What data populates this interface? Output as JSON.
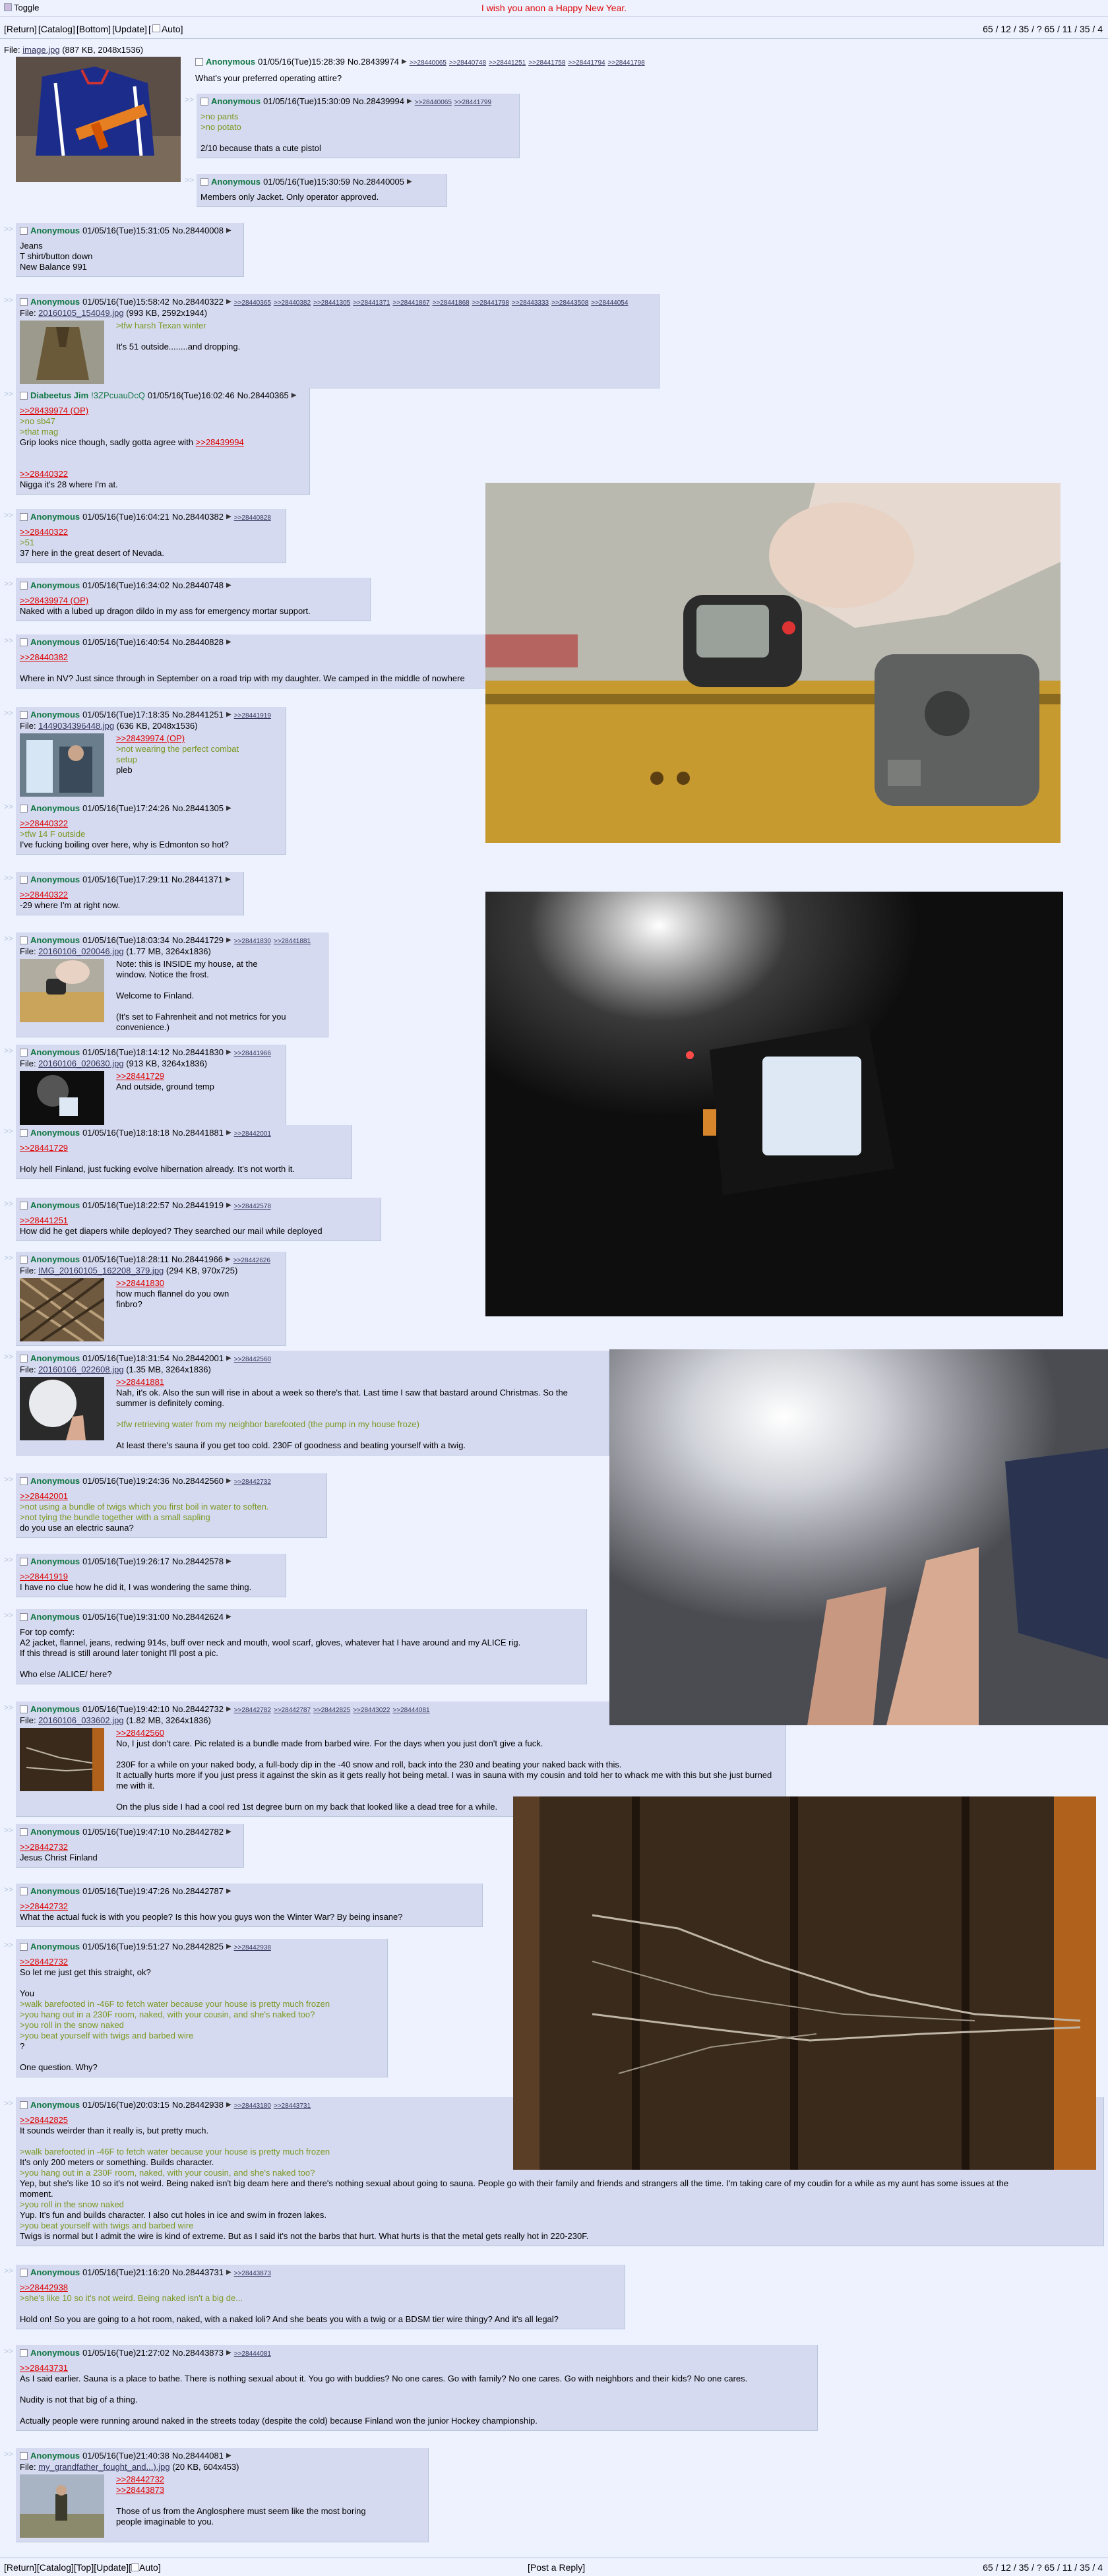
{
  "top": {
    "toggle_label": "Toggle",
    "greeting": "I wish you anon a Happy New Year.",
    "nav": [
      "[Return]",
      "[Catalog]",
      "[Bottom]",
      "[Update]",
      "[",
      "Auto]"
    ],
    "stats": "65 / 12 / 35 / ? 65 / 11 / 35 / 4"
  },
  "op": {
    "file_label": "File:",
    "file_name": "image.jpg",
    "file_meta": "(887 KB, 2048x1536)",
    "name": "Anonymous",
    "date": "01/05/16(Tue)15:28:39",
    "no": "No.28439974",
    "backlinks": [
      ">>28440065",
      ">>28440748",
      ">>28441251",
      ">>28441758",
      ">>28441794",
      ">>28441798"
    ],
    "message": "What's your preferred operating attire?"
  },
  "posts": [
    {
      "name": "Anonymous",
      "date": "01/05/16(Tue)15:30:09",
      "no": "No.28439994",
      "backlinks": [
        ">>28440065",
        ">>28441799"
      ],
      "lines": [
        {
          "t": "gt",
          "v": ">no pants"
        },
        {
          "t": "gt",
          "v": ">no potato"
        },
        {
          "t": "n",
          "v": ""
        },
        {
          "t": "n",
          "v": "2/10 because thats a cute pistol"
        }
      ]
    },
    {
      "name": "Anonymous",
      "date": "01/05/16(Tue)15:30:59",
      "no": "No.28440005",
      "backlinks": [],
      "lines": [
        {
          "t": "n",
          "v": "Members only Jacket. Only operator approved."
        }
      ]
    },
    {
      "name": "Anonymous",
      "date": "01/05/16(Tue)15:31:05",
      "no": "No.28440008",
      "backlinks": [],
      "lines": [
        {
          "t": "n",
          "v": "Jeans"
        },
        {
          "t": "n",
          "v": "T shirt/button down"
        },
        {
          "t": "n",
          "v": "New Balance 991"
        }
      ]
    },
    {
      "name": "Anonymous",
      "date": "01/05/16(Tue)15:58:42",
      "no": "No.28440322",
      "backlinks": [
        ">>28440365",
        ">>28440382",
        ">>28441305",
        ">>28441371",
        ">>28441867",
        ">>28441868",
        ">>28441798",
        ">>28443333",
        ">>28443508",
        ">>28444054"
      ],
      "file": {
        "name": "20160105_154049.jpg",
        "meta": "(993 KB, 2592x1944)"
      },
      "lines": [
        {
          "t": "gt",
          "v": ">tfw harsh Texan winter"
        },
        {
          "t": "n",
          "v": ""
        },
        {
          "t": "n",
          "v": "It's 51 outside........and dropping."
        }
      ]
    },
    {
      "name": "Diabeetus Jim",
      "trip": "!3ZPcuauDcQ",
      "date": "01/05/16(Tue)16:02:46",
      "no": "No.28440365",
      "backlinks": [],
      "lines": [
        {
          "t": "ql",
          "v": ">>28439974 (OP)"
        },
        {
          "t": "gt",
          "v": ">no sb47"
        },
        {
          "t": "gt",
          "v": ">that mag"
        },
        {
          "t": "mix",
          "v": "Grip looks nice though, sadly gotta agree with ",
          "q": ">>28439994"
        },
        {
          "t": "n",
          "v": ""
        },
        {
          "t": "n",
          "v": ""
        },
        {
          "t": "ql",
          "v": ">>28440322"
        },
        {
          "t": "n",
          "v": "Nigga it's 28 where I'm at."
        }
      ]
    },
    {
      "name": "Anonymous",
      "date": "01/05/16(Tue)16:04:21",
      "no": "No.28440382",
      "backlinks": [
        ">>28440828"
      ],
      "lines": [
        {
          "t": "ql",
          "v": ">>28440322"
        },
        {
          "t": "gt",
          "v": ">51"
        },
        {
          "t": "n",
          "v": "37 here in the great desert of Nevada."
        }
      ]
    },
    {
      "name": "Anonymous",
      "date": "01/05/16(Tue)16:34:02",
      "no": "No.28440748",
      "backlinks": [],
      "lines": [
        {
          "t": "ql",
          "v": ">>28439974 (OP)"
        },
        {
          "t": "n",
          "v": "Naked with a lubed up dragon dildo in my ass for emergency mortar support."
        }
      ]
    },
    {
      "name": "Anonymous",
      "date": "01/05/16(Tue)16:40:54",
      "no": "No.28440828",
      "backlinks": [],
      "lines": [
        {
          "t": "ql",
          "v": ">>28440382"
        },
        {
          "t": "n",
          "v": ""
        },
        {
          "t": "n",
          "v": "Where in NV? Just since through in September on a road trip with my daughter. We camped in the middle of nowhere"
        }
      ]
    },
    {
      "name": "Anonymous",
      "date": "01/05/16(Tue)17:18:35",
      "no": "No.28441251",
      "backlinks": [
        ">>28441919"
      ],
      "file": {
        "name": "1449034396448.jpg",
        "meta": "(636 KB, 2048x1536)"
      },
      "lines": [
        {
          "t": "ql",
          "v": ">>28439974 (OP)"
        },
        {
          "t": "gt",
          "v": ">not wearing the perfect combat"
        },
        {
          "t": "gt",
          "v": "setup"
        },
        {
          "t": "n",
          "v": "pleb"
        }
      ]
    },
    {
      "name": "Anonymous",
      "date": "01/05/16(Tue)17:24:26",
      "no": "No.28441305",
      "backlinks": [],
      "lines": [
        {
          "t": "ql",
          "v": ">>28440322"
        },
        {
          "t": "gt",
          "v": ">tfw 14 F outside"
        },
        {
          "t": "n",
          "v": "I've fucking boiling over here, why is Edmonton so hot?"
        }
      ]
    },
    {
      "name": "Anonymous",
      "date": "01/05/16(Tue)17:29:11",
      "no": "No.28441371",
      "backlinks": [],
      "lines": [
        {
          "t": "ql",
          "v": ">>28440322"
        },
        {
          "t": "n",
          "v": "-29 where I'm at right now."
        }
      ]
    },
    {
      "name": "Anonymous",
      "date": "01/05/16(Tue)18:03:34",
      "no": "No.28441729",
      "backlinks": [
        ">>28441830",
        ">>28441881"
      ],
      "file": {
        "name": "20160106_020046.jpg",
        "meta": "(1.77 MB, 3264x1836)"
      },
      "lines": [
        {
          "t": "n",
          "v": "Note: this is INSIDE my house, at the"
        },
        {
          "t": "n",
          "v": "window. Notice the frost."
        },
        {
          "t": "n",
          "v": ""
        },
        {
          "t": "n",
          "v": "Welcome to Finland."
        },
        {
          "t": "n",
          "v": ""
        },
        {
          "t": "n",
          "v": "(It's set to Fahrenheit and not metrics for you convenience.)"
        }
      ]
    },
    {
      "name": "Anonymous",
      "date": "01/05/16(Tue)18:14:12",
      "no": "No.28441830",
      "backlinks": [
        ">>28441966"
      ],
      "file": {
        "name": "20160106_020630.jpg",
        "meta": "(913 KB, 3264x1836)"
      },
      "lines": [
        {
          "t": "ql",
          "v": ">>28441729"
        },
        {
          "t": "n",
          "v": "And outside, ground temp"
        }
      ]
    },
    {
      "name": "Anonymous",
      "date": "01/05/16(Tue)18:18:18",
      "no": "No.28441881",
      "backlinks": [
        ">>28442001"
      ],
      "lines": [
        {
          "t": "ql",
          "v": ">>28441729"
        },
        {
          "t": "n",
          "v": ""
        },
        {
          "t": "n",
          "v": "Holy hell Finland, just fucking evolve hibernation already. It's not worth it."
        }
      ]
    },
    {
      "name": "Anonymous",
      "date": "01/05/16(Tue)18:22:57",
      "no": "No.28441919",
      "backlinks": [
        ">>28442578"
      ],
      "lines": [
        {
          "t": "ql",
          "v": ">>28441251"
        },
        {
          "t": "n",
          "v": "How did he get diapers while deployed? They searched our mail while deployed"
        }
      ]
    },
    {
      "name": "Anonymous",
      "date": "01/05/16(Tue)18:28:11",
      "no": "No.28441966",
      "backlinks": [
        ">>28442626"
      ],
      "file": {
        "name": "IMG_20160105_162208_379.jpg",
        "meta": "(294 KB, 970x725)"
      },
      "lines": [
        {
          "t": "ql",
          "v": ">>28441830"
        },
        {
          "t": "n",
          "v": "how much flannel do you own"
        },
        {
          "t": "n",
          "v": "finbro?"
        }
      ]
    },
    {
      "name": "Anonymous",
      "date": "01/05/16(Tue)18:31:54",
      "no": "No.28442001",
      "backlinks": [
        ">>28442560"
      ],
      "file": {
        "name": "20160106_022608.jpg",
        "meta": "(1.35 MB, 3264x1836)"
      },
      "lines": [
        {
          "t": "ql",
          "v": ">>28441881"
        },
        {
          "t": "n",
          "v": "Nah, it's ok. Also the sun will rise in about a week so there's that. Last time I saw that bastard around Christmas. So the"
        },
        {
          "t": "n",
          "v": "summer is definitely coming."
        },
        {
          "t": "n",
          "v": ""
        },
        {
          "t": "gt",
          "v": ">tfw retrieving water from my neighbor barefooted (the pump in my house froze)"
        },
        {
          "t": "n",
          "v": ""
        },
        {
          "t": "n",
          "v": "At least there's sauna if you get too cold. 230F of goodness and beating yourself with a twig."
        }
      ]
    },
    {
      "name": "Anonymous",
      "date": "01/05/16(Tue)19:24:36",
      "no": "No.28442560",
      "backlinks": [
        ">>28442732"
      ],
      "lines": [
        {
          "t": "ql",
          "v": ">>28442001"
        },
        {
          "t": "gt",
          "v": ">not using a bundle of twigs which you first boil in water to soften."
        },
        {
          "t": "gt",
          "v": ">not tying the bundle together with a small sapling"
        },
        {
          "t": "n",
          "v": "do you use an electric sauna?"
        }
      ]
    },
    {
      "name": "Anonymous",
      "date": "01/05/16(Tue)19:26:17",
      "no": "No.28442578",
      "backlinks": [],
      "lines": [
        {
          "t": "ql",
          "v": ">>28441919"
        },
        {
          "t": "n",
          "v": "I have no clue how he did it, I was wondering the same thing."
        }
      ]
    },
    {
      "name": "Anonymous",
      "date": "01/05/16(Tue)19:31:00",
      "no": "No.28442624",
      "backlinks": [],
      "lines": [
        {
          "t": "n",
          "v": "For top comfy:"
        },
        {
          "t": "n",
          "v": "A2 jacket, flannel, jeans, redwing 914s, buff over neck and mouth, wool scarf, gloves, whatever hat I have around and my ALICE rig."
        },
        {
          "t": "n",
          "v": "If this thread is still around later tonight I'll post a pic."
        },
        {
          "t": "n",
          "v": ""
        },
        {
          "t": "n",
          "v": "Who else /ALICE/ here?"
        }
      ]
    },
    {
      "name": "Anonymous",
      "date": "01/05/16(Tue)19:42:10",
      "no": "No.28442732",
      "backlinks": [
        ">>28442782",
        ">>28442787",
        ">>28442825",
        ">>28443022",
        ">>28444081"
      ],
      "file": {
        "name": "20160106_033602.jpg",
        "meta": "(1.82 MB, 3264x1836)"
      },
      "lines": [
        {
          "t": "ql",
          "v": ">>28442560"
        },
        {
          "t": "n",
          "v": "No, I just don't care. Pic related is a bundle made from barbed wire. For the days when you just don't give a fuck."
        },
        {
          "t": "n",
          "v": ""
        },
        {
          "t": "n",
          "v": "230F for a while on your naked body, a full-body dip in the -40 snow and roll, back into the 230 and beating your naked back with this."
        },
        {
          "t": "n",
          "v": "It actually hurts more if you just press it against the skin as it gets really hot being metal. I was in sauna with my cousin and told her to whack me with this but she just burned me with it."
        },
        {
          "t": "n",
          "v": ""
        },
        {
          "t": "n",
          "v": "On the plus side I had a cool red 1st degree burn on my back that looked like a dead tree for a while."
        }
      ]
    },
    {
      "name": "Anonymous",
      "date": "01/05/16(Tue)19:47:10",
      "no": "No.28442782",
      "backlinks": [],
      "lines": [
        {
          "t": "ql",
          "v": ">>28442732"
        },
        {
          "t": "n",
          "v": "Jesus Christ Finland"
        }
      ]
    },
    {
      "name": "Anonymous",
      "date": "01/05/16(Tue)19:47:26",
      "no": "No.28442787",
      "backlinks": [],
      "lines": [
        {
          "t": "ql",
          "v": ">>28442732"
        },
        {
          "t": "n",
          "v": "What the actual fuck is with you people? Is this how you guys won the Winter War? By being insane?"
        }
      ]
    },
    {
      "name": "Anonymous",
      "date": "01/05/16(Tue)19:51:27",
      "no": "No.28442825",
      "backlinks": [
        ">>28442938"
      ],
      "lines": [
        {
          "t": "ql",
          "v": ">>28442732"
        },
        {
          "t": "n",
          "v": "So let me just get this straight, ok?"
        },
        {
          "t": "n",
          "v": ""
        },
        {
          "t": "n",
          "v": "You"
        },
        {
          "t": "gt",
          "v": ">walk barefooted in -46F to fetch water because your house is pretty much frozen"
        },
        {
          "t": "gt",
          "v": ">you hang out in a 230F room, naked, with your cousin, and she's naked too?"
        },
        {
          "t": "gt",
          "v": ">you roll in the snow naked"
        },
        {
          "t": "gt",
          "v": ">you beat yourself with twigs and barbed wire"
        },
        {
          "t": "n",
          "v": "?"
        },
        {
          "t": "n",
          "v": ""
        },
        {
          "t": "n",
          "v": "One question. Why?"
        }
      ]
    },
    {
      "name": "Anonymous",
      "date": "01/05/16(Tue)20:03:15",
      "no": "No.28442938",
      "backlinks": [
        ">>28443180",
        ">>28443731"
      ],
      "lines": [
        {
          "t": "ql",
          "v": ">>28442825"
        },
        {
          "t": "n",
          "v": "It sounds weirder than it really is, but pretty much."
        },
        {
          "t": "n",
          "v": ""
        },
        {
          "t": "gt",
          "v": ">walk barefooted in -46F to fetch water because your house is pretty much frozen"
        },
        {
          "t": "n",
          "v": "It's only 200 meters or something. Builds character."
        },
        {
          "t": "gt",
          "v": ">you hang out in a 230F room, naked, with your cousin, and she's naked too?"
        },
        {
          "t": "n",
          "v": "Yep, but she's like 10 so it's not weird. Being naked isn't big deam here and there's nothing sexual about going to sauna. People go with their family and friends and strangers all the time. I'm taking care of my coudin for a while as my aunt has some issues at the"
        },
        {
          "t": "n",
          "v": "moment."
        },
        {
          "t": "gt",
          "v": ">you roll in the snow naked"
        },
        {
          "t": "n",
          "v": "Yup. It's fun and builds character. I also cut holes in ice and swim in frozen lakes."
        },
        {
          "t": "gt",
          "v": ">you beat yourself with twigs and barbed wire"
        },
        {
          "t": "n",
          "v": "Twigs is normal but I admit the wire is kind of extreme. But as I said it's not the barbs that hurt. What hurts is that the metal gets really hot in 220-230F."
        }
      ]
    },
    {
      "name": "Anonymous",
      "date": "01/05/16(Tue)21:16:20",
      "no": "No.28443731",
      "backlinks": [
        ">>28443873"
      ],
      "lines": [
        {
          "t": "ql",
          "v": ">>28442938"
        },
        {
          "t": "gt",
          "v": ">she's like 10 so it's not weird. Being naked isn't a big de..."
        },
        {
          "t": "n",
          "v": ""
        },
        {
          "t": "n",
          "v": "Hold on! So you are going to a hot room, naked, with a naked loli? And she beats you with a twig or a BDSM tier wire thingy? And it's all legal?"
        }
      ]
    },
    {
      "name": "Anonymous",
      "date": "01/05/16(Tue)21:27:02",
      "no": "No.28443873",
      "backlinks": [
        ">>28444081"
      ],
      "lines": [
        {
          "t": "ql",
          "v": ">>28443731"
        },
        {
          "t": "n",
          "v": "As I said earlier. Sauna is a place to bathe. There is nothing sexual about it. You go with buddies? No one cares. Go with family? No one cares. Go with neighbors and their kids? No one cares."
        },
        {
          "t": "n",
          "v": ""
        },
        {
          "t": "n",
          "v": "Nudity is not that big of a thing."
        },
        {
          "t": "n",
          "v": ""
        },
        {
          "t": "n",
          "v": "Actually people were running around naked in the streets today (despite the cold) because Finland won the junior Hockey championship."
        }
      ]
    },
    {
      "name": "Anonymous",
      "date": "01/05/16(Tue)21:40:38",
      "no": "No.28444081",
      "backlinks": [],
      "file": {
        "name": "my_grandfather_fought_and...).jpg",
        "meta": "(20 KB, 604x453)"
      },
      "lines": [
        {
          "t": "ql",
          "v": ">>28442732"
        },
        {
          "t": "ql",
          "v": ">>28443873"
        },
        {
          "t": "n",
          "v": ""
        },
        {
          "t": "n",
          "v": "Those of us from the Anglosphere must seem like the most boring"
        },
        {
          "t": "n",
          "v": "people imaginable to you."
        }
      ]
    }
  ],
  "bottom": {
    "nav": [
      "[Return]",
      "[Catalog]",
      "[Top]",
      "[Update]",
      "[",
      "Auto]"
    ],
    "post_reply": "[Post a Reply]",
    "stats": "65 / 12 / 35 / ? 65 / 11 / 35 / 4"
  },
  "colors": {
    "bg": "#eef2ff",
    "reply_bg": "#d6daf0",
    "name": "#117743",
    "quote": "#789922",
    "quotelink": "#dd0000"
  }
}
